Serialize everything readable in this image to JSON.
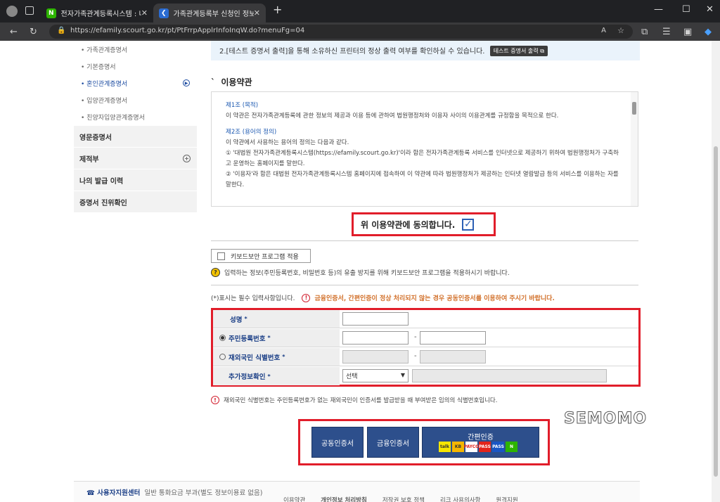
{
  "browser": {
    "tabs": [
      {
        "title": "전자가족관계등록시스템 : 네이버",
        "favicon": "N"
      },
      {
        "title": "가족관계등록부 신청인 정보 조회",
        "favicon": "court"
      }
    ],
    "url": "https://efamily.scourt.go.kr/pt/PtFrrpApplrInfoInqW.do?menuFg=04"
  },
  "sidebar": {
    "sub_items": [
      {
        "label": "• 가족관계증명서"
      },
      {
        "label": "• 기본증명서"
      },
      {
        "label": "• 혼인관계증명서"
      },
      {
        "label": "• 입양관계증명서"
      },
      {
        "label": "• 친양자입양관계증명서"
      }
    ],
    "main_items": [
      {
        "label": "영문증명서"
      },
      {
        "label": "제적부"
      },
      {
        "label": "나의 발급 이력"
      },
      {
        "label": "증명서 진위확인"
      }
    ]
  },
  "notice": {
    "text": "2.[테스트 증명서 출력]을 통해 소유하신 프린터의 정상 출력 여부를 확인하실 수 있습니다.",
    "button": "테스트 증명서 출력"
  },
  "terms": {
    "title": "이용약관",
    "article1_title": "제1조 (목적)",
    "article1_text": "이 약관은 전자가족관계등록에 관한 정보의 제공과 이용 등에 관하여 법원행정처와 이용자 사이의 이용관계를 규정함을 목적으로 한다.",
    "article2_title": "제2조 (용어의 정의)",
    "article2_text": "이 약관에서 사용하는 용어의 정의는 다음과 같다.",
    "item1": "① '대법원 전자가족관계등록시스템(https://efamily.scourt.go.kr)'이라 함은 전자가족관계등록 서비스를 인터넷으로 제공하기 위하여 법원행정처가 구축하고 운영하는 홈페이지를 말한다.",
    "item2": "② '이용자'라 함은 대법원 전자가족관계등록시스템 홈페이지에 접속하여 이 약관에 따라 법원행정처가 제공하는 인터넷 열람발급 등의 서비스를 이용하는 자를 말한다."
  },
  "agree": {
    "label": "위 이용약관에 동의합니다."
  },
  "keyboard": {
    "label": "키보드보안 프로그램 적용",
    "info": "입력하는 정보(주민등록번호, 비밀번호 등)의 유출 방지를 위해 키보드보안 프로그램을 적용하시기 바랍니다."
  },
  "required_note": "(*)표시는 필수 입력사항입니다.",
  "warning": "금융인증서, 간편인증이 정상 처리되지 않는 경우 공동인증서를 이용하여 주시기 바랍니다.",
  "form": {
    "name_label": "성명",
    "rrn_label": "주민등록번호",
    "foreign_label": "재외국민 식별번호",
    "extra_label": "추가정보확인",
    "star": "*",
    "dash": "-",
    "select_value": "선택"
  },
  "foot_note": "재외국민 식별번호는 주민등록번호가 없는 재외국민이 인증서를 발급받을 때 부여받은 임의의 식별번호입니다.",
  "auth": {
    "joint": "공동인증서",
    "financial": "금융인증서",
    "simple": "간편인증",
    "logos": [
      "talk",
      "KB",
      "PAYCO",
      "PASS",
      "PASS",
      "N"
    ]
  },
  "watermark": "SEMOMO",
  "footer": {
    "center": "사용자지원센터",
    "center_sub": "일반 통화요금 부과(별도 정보이용료 없음)",
    "links": [
      "이용약관",
      "개인정보 처리방침",
      "저작권 보호 정책",
      "리크 사용의사항",
      "원격지원"
    ]
  }
}
